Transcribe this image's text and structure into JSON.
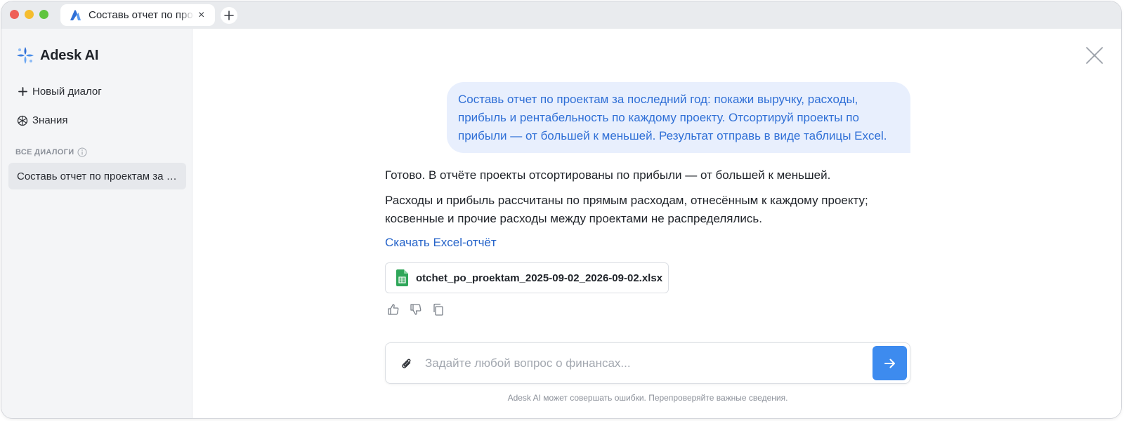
{
  "browser": {
    "tab_title": "Составь отчет по проектам за последний год",
    "tab_close": "×"
  },
  "sidebar": {
    "brand": "Adesk AI",
    "new_dialog": "Новый диалог",
    "knowledge": "Знания",
    "section_label": "ВСЕ ДИАЛОГИ",
    "dialogs": [
      {
        "title": "Составь отчет по проектам за последний год"
      }
    ]
  },
  "chat": {
    "user_message": "Составь отчет по проектам за последний год: покажи выручку, расходы, прибыль и рентабельность по каждому проекту. Отсортируй проекты по прибыли — от большей к меньшей. Результат отправь в виде таблицы Excel.",
    "answer_p1": "Готово. В отчёте проекты отсортированы по прибыли — от большей к меньшей.",
    "answer_p2": "Расходы и прибыль рассчитаны по прямым расходам, отнесённым к каждому проекту; косвенные и прочие расходы между проектами не распределялись.",
    "download_link": "Скачать Excel-отчёт",
    "file_name": "otchet_po_proektam_2025-09-02_2026-09-02.xlsx"
  },
  "composer": {
    "placeholder": "Задайте любой вопрос о финансах...",
    "value": ""
  },
  "disclaimer": "Adesk AI может совершать ошибки. Перепроверяйте важные сведения.",
  "colors": {
    "accent": "#3d8bef",
    "user_bubble_bg": "#e8effd",
    "user_bubble_text": "#2f6fd6",
    "link": "#2563c9",
    "excel_green": "#2fa659"
  }
}
